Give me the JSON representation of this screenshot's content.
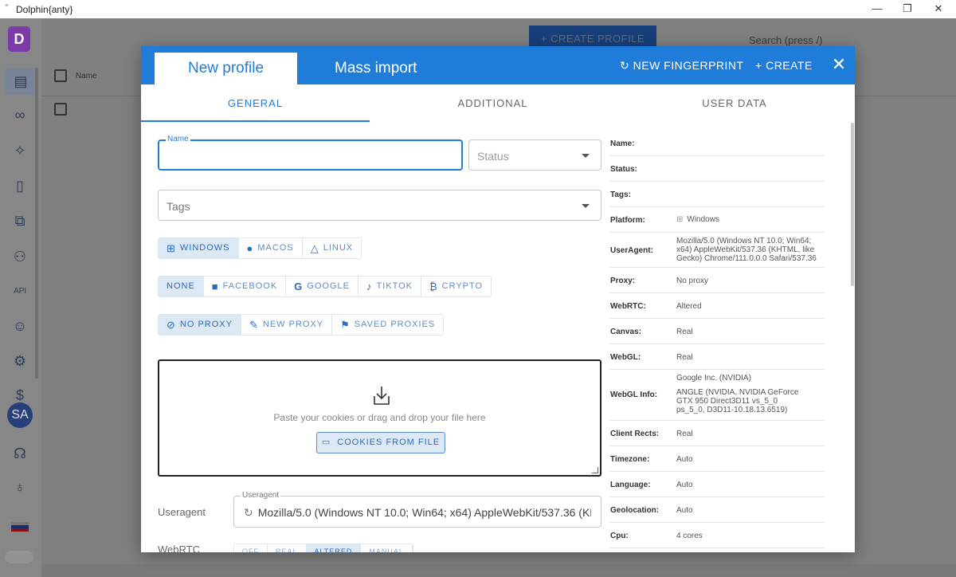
{
  "window": {
    "title": "Dolphin{anty}",
    "minimize": "—",
    "restore": "❐",
    "close": "✕"
  },
  "background": {
    "create_profile": "+ CREATE PROFILE",
    "search_placeholder": "Search (press /)",
    "table_header_name": "Name",
    "sidebar_avatar": "SA"
  },
  "modal": {
    "tabs_top": {
      "new_profile": "New profile",
      "mass_import": "Mass import"
    },
    "actions": {
      "new_fingerprint": "NEW FINGERPRINT",
      "create": "CREATE"
    },
    "tabs": [
      "GENERAL",
      "ADDITIONAL",
      "USER DATA"
    ],
    "form": {
      "name_label": "Name",
      "name_value": "",
      "status_placeholder": "Status",
      "tags_placeholder": "Tags",
      "os_options": [
        {
          "label": "WINDOWS",
          "icon": "windows-icon",
          "selected": true
        },
        {
          "label": "MACOS",
          "icon": "apple-icon",
          "selected": false
        },
        {
          "label": "LINUX",
          "icon": "linux-icon",
          "selected": false
        }
      ],
      "platform_options": [
        {
          "label": "NONE",
          "icon": "",
          "selected": true
        },
        {
          "label": "FACEBOOK",
          "icon": "facebook-icon",
          "selected": false
        },
        {
          "label": "GOOGLE",
          "icon": "google-icon",
          "selected": false
        },
        {
          "label": "TIKTOK",
          "icon": "tiktok-icon",
          "selected": false
        },
        {
          "label": "CRYPTO",
          "icon": "bitcoin-icon",
          "selected": false
        }
      ],
      "proxy_options": [
        {
          "label": "NO PROXY",
          "icon": "no-proxy-icon",
          "selected": true
        },
        {
          "label": "NEW PROXY",
          "icon": "edit-icon",
          "selected": false
        },
        {
          "label": "SAVED PROXIES",
          "icon": "bookmark-icon",
          "selected": false
        }
      ],
      "cookies_text": "Paste your cookies or drag and drop your file here",
      "cookies_button": "COOKIES FROM FILE",
      "useragent_label": "Useragent",
      "useragent_field_label": "Useragent",
      "useragent_value": "Mozilla/5.0 (Windows NT 10.0; Win64; x64) AppleWebKit/537.36 (KHTML, like Gecko) Chrome/111.0.0.0 Safari/537.36",
      "webrtc_label": "WebRTC",
      "webrtc_options": [
        {
          "label": "OFF",
          "selected": false
        },
        {
          "label": "REAL",
          "selected": false
        },
        {
          "label": "ALTERED",
          "selected": true
        },
        {
          "label": "MANUAL",
          "selected": false
        }
      ]
    },
    "summary": [
      {
        "key": "Name:",
        "value": ""
      },
      {
        "key": "Status:",
        "value": ""
      },
      {
        "key": "Tags:",
        "value": ""
      },
      {
        "key": "Platform:",
        "value": "Windows"
      },
      {
        "key": "UserAgent:",
        "value": "Mozilla/5.0 (Windows NT 10.0; Win64; x64) AppleWebKit/537.36 (KHTML, like Gecko) Chrome/111.0.0.0 Safari/537.36"
      },
      {
        "key": "Proxy:",
        "value": "No proxy"
      },
      {
        "key": "WebRTC:",
        "value": "Altered"
      },
      {
        "key": "Canvas:",
        "value": "Real"
      },
      {
        "key": "WebGL:",
        "value": "Real"
      },
      {
        "key": "WebGL Info:",
        "value": "Google Inc. (NVIDIA)",
        "value2": "ANGLE (NVIDIA, NVIDIA GeForce GTX 950 Direct3D11 vs_5_0 ps_5_0, D3D11-10.18.13.6519)"
      },
      {
        "key": "Client Rects:",
        "value": "Real"
      },
      {
        "key": "Timezone:",
        "value": "Auto"
      },
      {
        "key": "Language:",
        "value": "Auto"
      },
      {
        "key": "Geolocation:",
        "value": "Auto"
      },
      {
        "key": "Cpu:",
        "value": "4 cores"
      }
    ]
  }
}
